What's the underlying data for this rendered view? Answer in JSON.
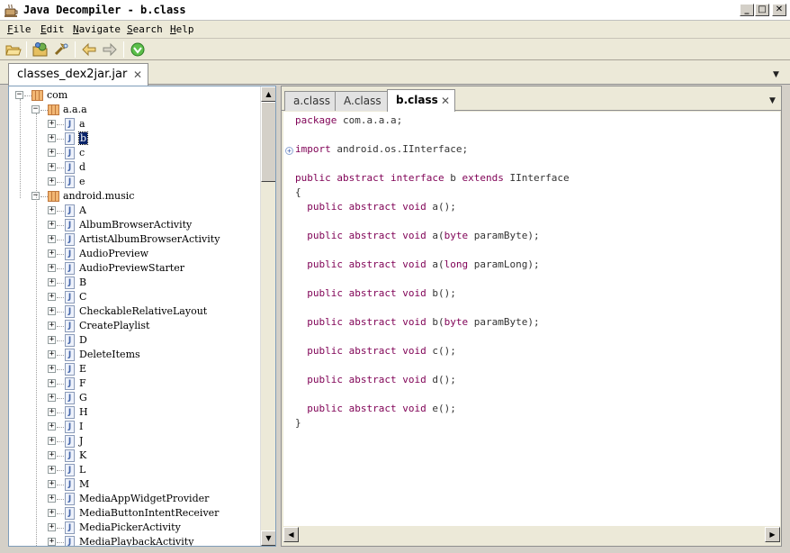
{
  "window": {
    "title": "Java Decompiler - b.class",
    "minimize_glyph": "_",
    "maximize_glyph": "□",
    "close_glyph": "✕"
  },
  "menu": [
    {
      "mnemonic": "F",
      "rest": "ile"
    },
    {
      "mnemonic": "E",
      "rest": "dit"
    },
    {
      "mnemonic": "N",
      "rest": "avigate"
    },
    {
      "mnemonic": "S",
      "rest": "earch"
    },
    {
      "mnemonic": "H",
      "rest": "elp"
    }
  ],
  "toolbar": {
    "icons": [
      "open-file-icon",
      "open-type-icon",
      "search-icon",
      "back-icon",
      "forward-icon",
      "about-icon"
    ]
  },
  "outer_tab": {
    "label": "classes_dex2jar.jar",
    "close_glyph": "✕"
  },
  "tree": {
    "root": "com",
    "packages": [
      {
        "name": "a.a.a",
        "classes": [
          "a",
          "b",
          "c",
          "d",
          "e"
        ],
        "selected": "b"
      },
      {
        "name": "android.music",
        "classes": [
          "A",
          "AlbumBrowserActivity",
          "ArtistAlbumBrowserActivity",
          "AudioPreview",
          "AudioPreviewStarter",
          "B",
          "C",
          "CheckableRelativeLayout",
          "CreatePlaylist",
          "D",
          "DeleteItems",
          "E",
          "F",
          "G",
          "H",
          "I",
          "J",
          "K",
          "L",
          "M",
          "MediaAppWidgetProvider",
          "MediaButtonIntentReceiver",
          "MediaPickerActivity",
          "MediaPlaybackActivity"
        ]
      }
    ],
    "expand_glyph": "+",
    "collapse_glyph": "−",
    "class_icon_letter": "J"
  },
  "editor_tabs": [
    {
      "label": "a.class",
      "active": false
    },
    {
      "label": "A.class",
      "active": false
    },
    {
      "label": "b.class",
      "active": true
    }
  ],
  "code": {
    "lines": [
      [
        {
          "t": "package",
          "kw": true
        },
        {
          "t": " com.a.a.a;"
        }
      ],
      [],
      [
        {
          "t": "import",
          "kw": true
        },
        {
          "t": " android.os.IInterface;"
        }
      ],
      [],
      [
        {
          "t": "public",
          "kw": true
        },
        {
          "t": " "
        },
        {
          "t": "abstract",
          "kw": true
        },
        {
          "t": " "
        },
        {
          "t": "interface",
          "kw": true
        },
        {
          "t": " b "
        },
        {
          "t": "extends",
          "kw": true
        },
        {
          "t": " IInterface"
        }
      ],
      [
        {
          "t": "{"
        }
      ],
      [
        {
          "t": "  "
        },
        {
          "t": "public",
          "kw": true
        },
        {
          "t": " "
        },
        {
          "t": "abstract",
          "kw": true
        },
        {
          "t": " "
        },
        {
          "t": "void",
          "kw": true
        },
        {
          "t": " a();"
        }
      ],
      [],
      [
        {
          "t": "  "
        },
        {
          "t": "public",
          "kw": true
        },
        {
          "t": " "
        },
        {
          "t": "abstract",
          "kw": true
        },
        {
          "t": " "
        },
        {
          "t": "void",
          "kw": true
        },
        {
          "t": " a("
        },
        {
          "t": "byte",
          "kw": true
        },
        {
          "t": " paramByte);"
        }
      ],
      [],
      [
        {
          "t": "  "
        },
        {
          "t": "public",
          "kw": true
        },
        {
          "t": " "
        },
        {
          "t": "abstract",
          "kw": true
        },
        {
          "t": " "
        },
        {
          "t": "void",
          "kw": true
        },
        {
          "t": " a("
        },
        {
          "t": "long",
          "kw": true
        },
        {
          "t": " paramLong);"
        }
      ],
      [],
      [
        {
          "t": "  "
        },
        {
          "t": "public",
          "kw": true
        },
        {
          "t": " "
        },
        {
          "t": "abstract",
          "kw": true
        },
        {
          "t": " "
        },
        {
          "t": "void",
          "kw": true
        },
        {
          "t": " b();"
        }
      ],
      [],
      [
        {
          "t": "  "
        },
        {
          "t": "public",
          "kw": true
        },
        {
          "t": " "
        },
        {
          "t": "abstract",
          "kw": true
        },
        {
          "t": " "
        },
        {
          "t": "void",
          "kw": true
        },
        {
          "t": " b("
        },
        {
          "t": "byte",
          "kw": true
        },
        {
          "t": " paramByte);"
        }
      ],
      [],
      [
        {
          "t": "  "
        },
        {
          "t": "public",
          "kw": true
        },
        {
          "t": " "
        },
        {
          "t": "abstract",
          "kw": true
        },
        {
          "t": " "
        },
        {
          "t": "void",
          "kw": true
        },
        {
          "t": " c();"
        }
      ],
      [],
      [
        {
          "t": "  "
        },
        {
          "t": "public",
          "kw": true
        },
        {
          "t": " "
        },
        {
          "t": "abstract",
          "kw": true
        },
        {
          "t": " "
        },
        {
          "t": "void",
          "kw": true
        },
        {
          "t": " d();"
        }
      ],
      [],
      [
        {
          "t": "  "
        },
        {
          "t": "public",
          "kw": true
        },
        {
          "t": " "
        },
        {
          "t": "abstract",
          "kw": true
        },
        {
          "t": " "
        },
        {
          "t": "void",
          "kw": true
        },
        {
          "t": " e();"
        }
      ],
      [
        {
          "t": "}"
        }
      ]
    ],
    "fold_glyph": "+",
    "colors": {
      "keyword": "#7f0055",
      "text": "#333333"
    }
  },
  "scroll_glyphs": {
    "up": "▲",
    "down": "▼",
    "left": "◀",
    "right": "▶"
  },
  "dropdown_glyph": "▼"
}
